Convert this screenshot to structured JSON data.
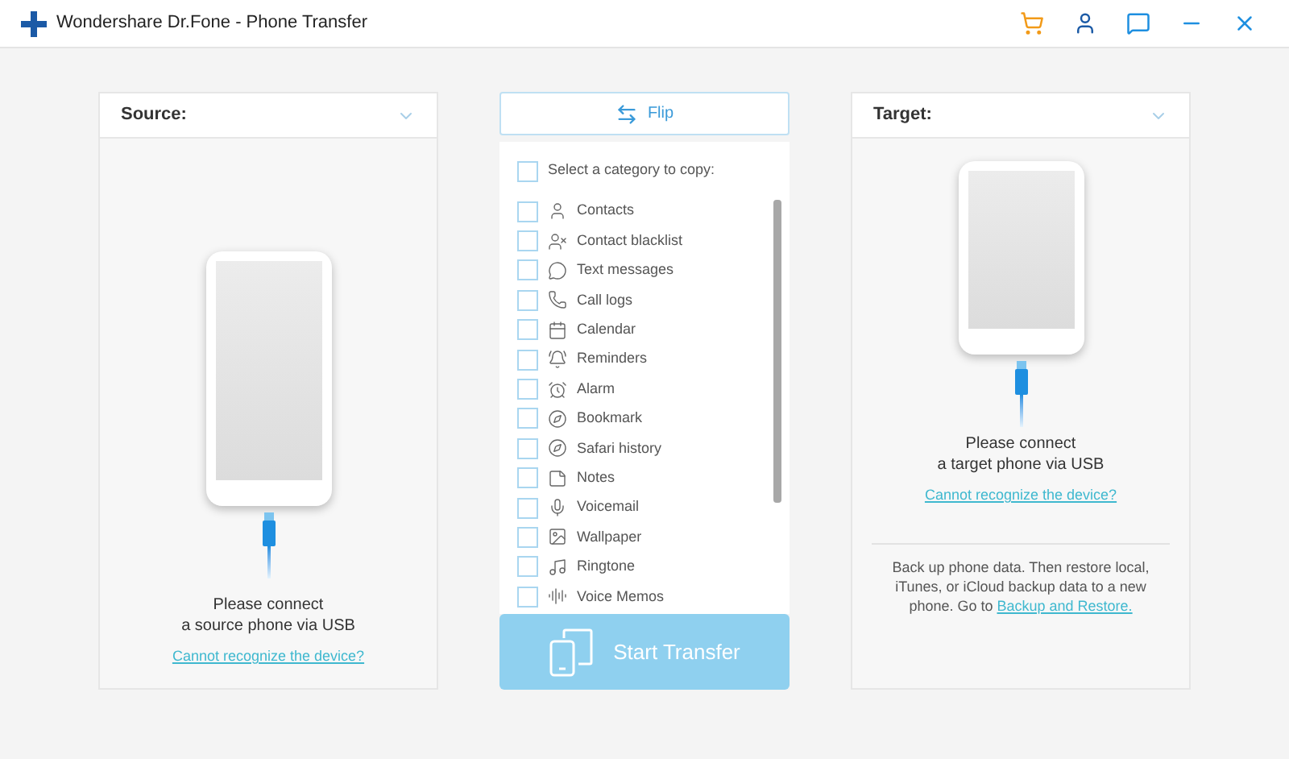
{
  "window": {
    "title": "Wondershare Dr.Fone - Phone Transfer"
  },
  "source": {
    "label": "Source:",
    "message_lines": [
      "Please connect",
      "a source phone via USB"
    ],
    "link": "Cannot recognize the device?"
  },
  "flip_button": {
    "label": "Flip"
  },
  "categories": {
    "select_all": {
      "label": "Select a category to copy:",
      "checked": false
    },
    "items": [
      {
        "label": "Contacts",
        "checked": false
      },
      {
        "label": "Contact blacklist",
        "checked": false
      },
      {
        "label": "Text messages",
        "checked": false
      },
      {
        "label": "Call logs",
        "checked": false
      },
      {
        "label": "Calendar",
        "checked": false
      },
      {
        "label": "Reminders",
        "checked": false
      },
      {
        "label": "Alarm",
        "checked": false
      },
      {
        "label": "Bookmark",
        "checked": false
      },
      {
        "label": "Safari history",
        "checked": false
      },
      {
        "label": "Notes",
        "checked": false
      },
      {
        "label": "Voicemail",
        "checked": false
      },
      {
        "label": "Wallpaper",
        "checked": false
      },
      {
        "label": "Ringtone",
        "checked": false
      },
      {
        "label": "Voice Memos",
        "checked": false
      }
    ]
  },
  "start_button": {
    "label": "Start Transfer",
    "disabled": true
  },
  "target": {
    "label": "Target:",
    "message_lines": [
      "Please connect",
      "a target phone via USB"
    ],
    "link": "Cannot recognize the device?",
    "backup_text": "Back up phone data. Then restore local, iTunes, or iCloud backup data to a new phone. Go to",
    "backup_link": "Backup and Restore."
  }
}
